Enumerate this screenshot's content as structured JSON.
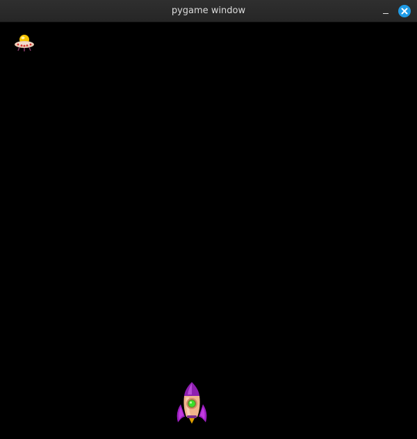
{
  "window": {
    "title": "pygame window",
    "background": "#000000",
    "controls": {
      "minimize_icon": "minimize-icon",
      "close_icon": "close-icon",
      "close_color": "#1f9be6"
    }
  },
  "game": {
    "sprites": [
      {
        "name": "enemy-ufo",
        "icon": "ufo-icon"
      },
      {
        "name": "player-rocket",
        "icon": "rocket-icon"
      }
    ]
  }
}
